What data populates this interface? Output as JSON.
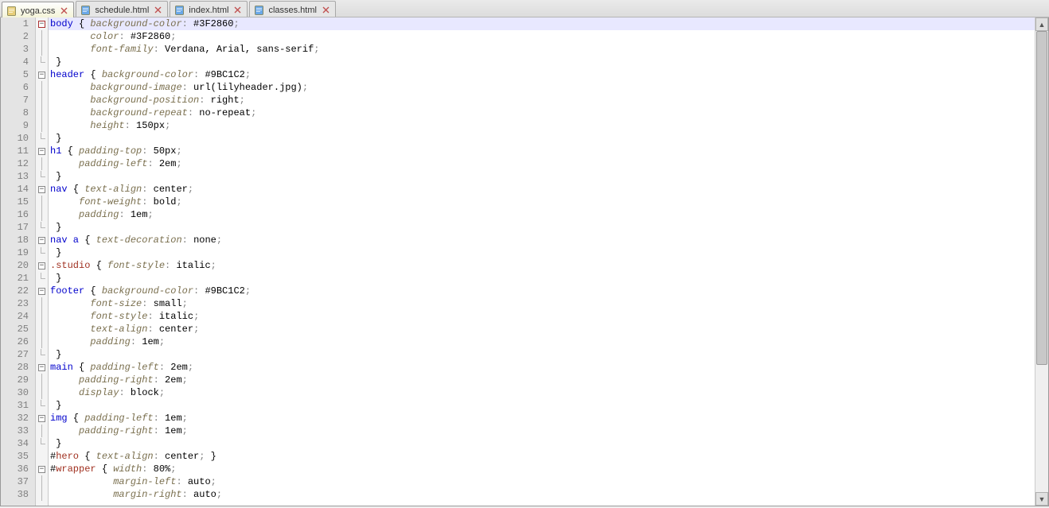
{
  "tabs": [
    {
      "label": "yoga.css",
      "icon": "css",
      "active": true
    },
    {
      "label": "schedule.html",
      "icon": "html",
      "active": false
    },
    {
      "label": "index.html",
      "icon": "html",
      "active": false
    },
    {
      "label": "classes.html",
      "icon": "html",
      "active": false
    }
  ],
  "lineCount": 38,
  "activeLine": 1,
  "scroll": {
    "thumbTopPx": 17,
    "thumbHeightPx": 420
  },
  "code": [
    {
      "fold": "open-first",
      "tokens": [
        {
          "c": "t-sel",
          "t": "body"
        },
        {
          "c": "",
          "t": " { "
        },
        {
          "c": "t-prop",
          "t": "background-color"
        },
        {
          "c": "t-grey",
          "t": ": "
        },
        {
          "c": "t-val",
          "t": "#3F2860"
        },
        {
          "c": "t-grey",
          "t": ";"
        }
      ]
    },
    {
      "fold": "bar",
      "tokens": [
        {
          "c": "",
          "t": "       "
        },
        {
          "c": "t-prop",
          "t": "color"
        },
        {
          "c": "t-grey",
          "t": ": "
        },
        {
          "c": "t-val",
          "t": "#3F2860"
        },
        {
          "c": "t-grey",
          "t": ";"
        }
      ]
    },
    {
      "fold": "bar",
      "tokens": [
        {
          "c": "",
          "t": "       "
        },
        {
          "c": "t-prop",
          "t": "font-family"
        },
        {
          "c": "t-grey",
          "t": ": "
        },
        {
          "c": "t-val",
          "t": "Verdana, Arial, sans-serif"
        },
        {
          "c": "t-grey",
          "t": ";"
        }
      ]
    },
    {
      "fold": "end",
      "tokens": [
        {
          "c": "",
          "t": " }"
        }
      ]
    },
    {
      "fold": "open",
      "tokens": [
        {
          "c": "t-sel",
          "t": "header"
        },
        {
          "c": "",
          "t": " { "
        },
        {
          "c": "t-prop",
          "t": "background-color"
        },
        {
          "c": "t-grey",
          "t": ": "
        },
        {
          "c": "t-val",
          "t": "#9BC1C2"
        },
        {
          "c": "t-grey",
          "t": ";"
        }
      ]
    },
    {
      "fold": "bar",
      "tokens": [
        {
          "c": "",
          "t": "       "
        },
        {
          "c": "t-prop",
          "t": "background-image"
        },
        {
          "c": "t-grey",
          "t": ": "
        },
        {
          "c": "t-val",
          "t": "url(lilyheader.jpg)"
        },
        {
          "c": "t-grey",
          "t": ";"
        }
      ]
    },
    {
      "fold": "bar",
      "tokens": [
        {
          "c": "",
          "t": "       "
        },
        {
          "c": "t-prop",
          "t": "background-position"
        },
        {
          "c": "t-grey",
          "t": ": "
        },
        {
          "c": "t-val",
          "t": "right"
        },
        {
          "c": "t-grey",
          "t": ";"
        }
      ]
    },
    {
      "fold": "bar",
      "tokens": [
        {
          "c": "",
          "t": "       "
        },
        {
          "c": "t-prop",
          "t": "background-repeat"
        },
        {
          "c": "t-grey",
          "t": ": "
        },
        {
          "c": "t-val",
          "t": "no-repeat"
        },
        {
          "c": "t-grey",
          "t": ";"
        }
      ]
    },
    {
      "fold": "bar",
      "tokens": [
        {
          "c": "",
          "t": "       "
        },
        {
          "c": "t-prop",
          "t": "height"
        },
        {
          "c": "t-grey",
          "t": ": "
        },
        {
          "c": "t-val",
          "t": "150px"
        },
        {
          "c": "t-grey",
          "t": ";"
        }
      ]
    },
    {
      "fold": "end",
      "tokens": [
        {
          "c": "",
          "t": " }"
        }
      ]
    },
    {
      "fold": "open",
      "tokens": [
        {
          "c": "t-sel",
          "t": "h1"
        },
        {
          "c": "",
          "t": " { "
        },
        {
          "c": "t-prop",
          "t": "padding-top"
        },
        {
          "c": "t-grey",
          "t": ": "
        },
        {
          "c": "t-val",
          "t": "50px"
        },
        {
          "c": "t-grey",
          "t": ";"
        }
      ]
    },
    {
      "fold": "bar",
      "tokens": [
        {
          "c": "",
          "t": "     "
        },
        {
          "c": "t-prop",
          "t": "padding-left"
        },
        {
          "c": "t-grey",
          "t": ": "
        },
        {
          "c": "t-val",
          "t": "2em"
        },
        {
          "c": "t-grey",
          "t": ";"
        }
      ]
    },
    {
      "fold": "end",
      "tokens": [
        {
          "c": "",
          "t": " }"
        }
      ]
    },
    {
      "fold": "open",
      "tokens": [
        {
          "c": "t-sel",
          "t": "nav"
        },
        {
          "c": "",
          "t": " { "
        },
        {
          "c": "t-prop",
          "t": "text-align"
        },
        {
          "c": "t-grey",
          "t": ": "
        },
        {
          "c": "t-val",
          "t": "center"
        },
        {
          "c": "t-grey",
          "t": ";"
        }
      ]
    },
    {
      "fold": "bar",
      "tokens": [
        {
          "c": "",
          "t": "     "
        },
        {
          "c": "t-prop",
          "t": "font-weight"
        },
        {
          "c": "t-grey",
          "t": ": "
        },
        {
          "c": "t-val",
          "t": "bold"
        },
        {
          "c": "t-grey",
          "t": ";"
        }
      ]
    },
    {
      "fold": "bar",
      "tokens": [
        {
          "c": "",
          "t": "     "
        },
        {
          "c": "t-prop",
          "t": "padding"
        },
        {
          "c": "t-grey",
          "t": ": "
        },
        {
          "c": "t-val",
          "t": "1em"
        },
        {
          "c": "t-grey",
          "t": ";"
        }
      ]
    },
    {
      "fold": "end",
      "tokens": [
        {
          "c": "",
          "t": " }"
        }
      ]
    },
    {
      "fold": "open",
      "tokens": [
        {
          "c": "t-sel",
          "t": "nav a"
        },
        {
          "c": "",
          "t": " { "
        },
        {
          "c": "t-prop",
          "t": "text-decoration"
        },
        {
          "c": "t-grey",
          "t": ": "
        },
        {
          "c": "t-val",
          "t": "none"
        },
        {
          "c": "t-grey",
          "t": ";"
        }
      ]
    },
    {
      "fold": "end",
      "tokens": [
        {
          "c": "",
          "t": " }"
        }
      ]
    },
    {
      "fold": "open",
      "tokens": [
        {
          "c": "t-class",
          "t": ".studio"
        },
        {
          "c": "",
          "t": " { "
        },
        {
          "c": "t-prop",
          "t": "font-style"
        },
        {
          "c": "t-grey",
          "t": ": "
        },
        {
          "c": "t-val",
          "t": "italic"
        },
        {
          "c": "t-grey",
          "t": ";"
        }
      ]
    },
    {
      "fold": "end",
      "tokens": [
        {
          "c": "",
          "t": " }"
        }
      ]
    },
    {
      "fold": "open",
      "tokens": [
        {
          "c": "t-sel",
          "t": "footer"
        },
        {
          "c": "",
          "t": " { "
        },
        {
          "c": "t-prop",
          "t": "background-color"
        },
        {
          "c": "t-grey",
          "t": ": "
        },
        {
          "c": "t-val",
          "t": "#9BC1C2"
        },
        {
          "c": "t-grey",
          "t": ";"
        }
      ]
    },
    {
      "fold": "bar",
      "tokens": [
        {
          "c": "",
          "t": "       "
        },
        {
          "c": "t-prop",
          "t": "font-size"
        },
        {
          "c": "t-grey",
          "t": ": "
        },
        {
          "c": "t-val",
          "t": "small"
        },
        {
          "c": "t-grey",
          "t": ";"
        }
      ]
    },
    {
      "fold": "bar",
      "tokens": [
        {
          "c": "",
          "t": "       "
        },
        {
          "c": "t-prop",
          "t": "font-style"
        },
        {
          "c": "t-grey",
          "t": ": "
        },
        {
          "c": "t-val",
          "t": "italic"
        },
        {
          "c": "t-grey",
          "t": ";"
        }
      ]
    },
    {
      "fold": "bar",
      "tokens": [
        {
          "c": "",
          "t": "       "
        },
        {
          "c": "t-prop",
          "t": "text-align"
        },
        {
          "c": "t-grey",
          "t": ": "
        },
        {
          "c": "t-val",
          "t": "center"
        },
        {
          "c": "t-grey",
          "t": ";"
        }
      ]
    },
    {
      "fold": "bar",
      "tokens": [
        {
          "c": "",
          "t": "       "
        },
        {
          "c": "t-prop",
          "t": "padding"
        },
        {
          "c": "t-grey",
          "t": ": "
        },
        {
          "c": "t-val",
          "t": "1em"
        },
        {
          "c": "t-grey",
          "t": ";"
        }
      ]
    },
    {
      "fold": "end",
      "tokens": [
        {
          "c": "",
          "t": " }"
        }
      ]
    },
    {
      "fold": "open",
      "tokens": [
        {
          "c": "t-sel",
          "t": "main"
        },
        {
          "c": "",
          "t": " { "
        },
        {
          "c": "t-prop",
          "t": "padding-left"
        },
        {
          "c": "t-grey",
          "t": ": "
        },
        {
          "c": "t-val",
          "t": "2em"
        },
        {
          "c": "t-grey",
          "t": ";"
        }
      ]
    },
    {
      "fold": "bar",
      "tokens": [
        {
          "c": "",
          "t": "     "
        },
        {
          "c": "t-prop",
          "t": "padding-right"
        },
        {
          "c": "t-grey",
          "t": ": "
        },
        {
          "c": "t-val",
          "t": "2em"
        },
        {
          "c": "t-grey",
          "t": ";"
        }
      ]
    },
    {
      "fold": "bar",
      "tokens": [
        {
          "c": "",
          "t": "     "
        },
        {
          "c": "t-prop",
          "t": "display"
        },
        {
          "c": "t-grey",
          "t": ": "
        },
        {
          "c": "t-val",
          "t": "block"
        },
        {
          "c": "t-grey",
          "t": ";"
        }
      ]
    },
    {
      "fold": "end",
      "tokens": [
        {
          "c": "",
          "t": " }"
        }
      ]
    },
    {
      "fold": "open",
      "tokens": [
        {
          "c": "t-sel",
          "t": "img"
        },
        {
          "c": "",
          "t": " { "
        },
        {
          "c": "t-prop",
          "t": "padding-left"
        },
        {
          "c": "t-grey",
          "t": ": "
        },
        {
          "c": "t-val",
          "t": "1em"
        },
        {
          "c": "t-grey",
          "t": ";"
        }
      ]
    },
    {
      "fold": "bar",
      "tokens": [
        {
          "c": "",
          "t": "     "
        },
        {
          "c": "t-prop",
          "t": "padding-right"
        },
        {
          "c": "t-grey",
          "t": ": "
        },
        {
          "c": "t-val",
          "t": "1em"
        },
        {
          "c": "t-grey",
          "t": ";"
        }
      ]
    },
    {
      "fold": "end",
      "tokens": [
        {
          "c": "",
          "t": " }"
        }
      ]
    },
    {
      "fold": "",
      "tokens": [
        {
          "c": "t-val",
          "t": "#"
        },
        {
          "c": "t-class",
          "t": "hero"
        },
        {
          "c": "",
          "t": " { "
        },
        {
          "c": "t-prop",
          "t": "text-align"
        },
        {
          "c": "t-grey",
          "t": ": "
        },
        {
          "c": "t-val",
          "t": "center"
        },
        {
          "c": "t-grey",
          "t": ";"
        },
        {
          "c": "",
          "t": " }"
        }
      ]
    },
    {
      "fold": "open",
      "tokens": [
        {
          "c": "t-val",
          "t": "#"
        },
        {
          "c": "t-class",
          "t": "wrapper"
        },
        {
          "c": "",
          "t": " { "
        },
        {
          "c": "t-prop",
          "t": "width"
        },
        {
          "c": "t-grey",
          "t": ": "
        },
        {
          "c": "t-val",
          "t": "80%"
        },
        {
          "c": "t-grey",
          "t": ";"
        }
      ]
    },
    {
      "fold": "bar",
      "tokens": [
        {
          "c": "",
          "t": "           "
        },
        {
          "c": "t-prop",
          "t": "margin-left"
        },
        {
          "c": "t-grey",
          "t": ": "
        },
        {
          "c": "t-val",
          "t": "auto"
        },
        {
          "c": "t-grey",
          "t": ";"
        }
      ]
    },
    {
      "fold": "bar",
      "tokens": [
        {
          "c": "",
          "t": "           "
        },
        {
          "c": "t-prop",
          "t": "margin-right"
        },
        {
          "c": "t-grey",
          "t": ": "
        },
        {
          "c": "t-val",
          "t": "auto"
        },
        {
          "c": "t-grey",
          "t": ";"
        }
      ]
    }
  ]
}
